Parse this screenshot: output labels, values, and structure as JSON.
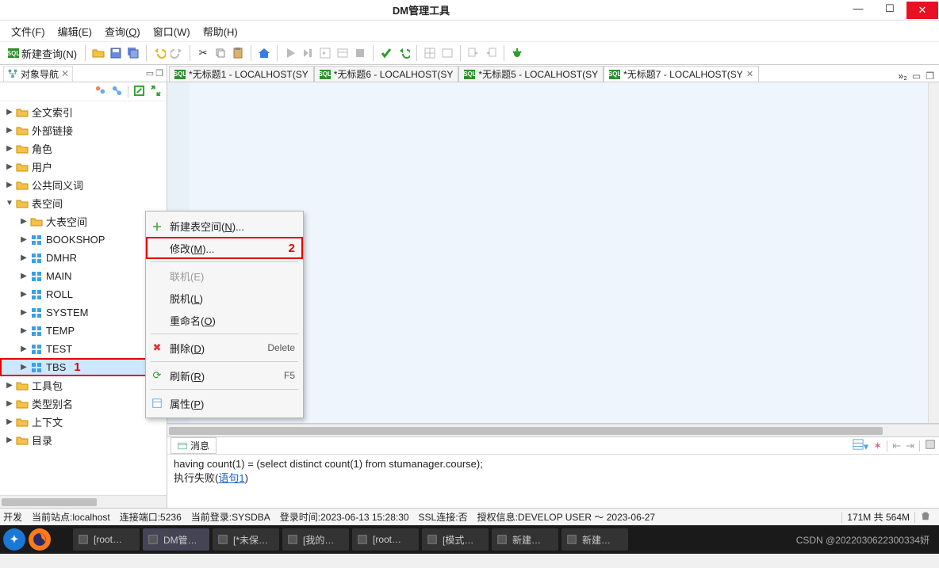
{
  "window": {
    "title": "DM管理工具"
  },
  "menu": {
    "file": "文件(F)",
    "edit": "编辑(E)",
    "query": "查询(Q)",
    "window": "窗口(W)",
    "help": "帮助(H)"
  },
  "toolbar": {
    "new_query": "新建查询(N)"
  },
  "nav_panel": {
    "title": "对象导航"
  },
  "tree": {
    "items": [
      {
        "label": "全文索引",
        "kind": "folder",
        "depth": 1,
        "twisty": "▶"
      },
      {
        "label": "外部链接",
        "kind": "folder",
        "depth": 1,
        "twisty": "▶"
      },
      {
        "label": "角色",
        "kind": "folder",
        "depth": 1,
        "twisty": "▶"
      },
      {
        "label": "用户",
        "kind": "folder",
        "depth": 1,
        "twisty": "▶"
      },
      {
        "label": "公共同义词",
        "kind": "folder",
        "depth": 1,
        "twisty": "▶"
      },
      {
        "label": "表空间",
        "kind": "folder",
        "depth": 1,
        "twisty": "▼"
      },
      {
        "label": "大表空间",
        "kind": "folder",
        "depth": 2,
        "twisty": "▶"
      },
      {
        "label": "BOOKSHOP",
        "kind": "tbs",
        "depth": 2,
        "twisty": "▶"
      },
      {
        "label": "DMHR",
        "kind": "tbs",
        "depth": 2,
        "twisty": "▶"
      },
      {
        "label": "MAIN",
        "kind": "tbs",
        "depth": 2,
        "twisty": "▶"
      },
      {
        "label": "ROLL",
        "kind": "tbs",
        "depth": 2,
        "twisty": "▶"
      },
      {
        "label": "SYSTEM",
        "kind": "tbs",
        "depth": 2,
        "twisty": "▶"
      },
      {
        "label": "TEMP",
        "kind": "tbs",
        "depth": 2,
        "twisty": "▶"
      },
      {
        "label": "TEST",
        "kind": "tbs",
        "depth": 2,
        "twisty": "▶"
      },
      {
        "label": "TBS",
        "kind": "tbs",
        "depth": 2,
        "twisty": "▶",
        "selected": true,
        "hl": "1"
      },
      {
        "label": "工具包",
        "kind": "folder",
        "depth": 1,
        "twisty": "▶"
      },
      {
        "label": "类型别名",
        "kind": "folder",
        "depth": 1,
        "twisty": "▶"
      },
      {
        "label": "上下文",
        "kind": "folder",
        "depth": 1,
        "twisty": "▶"
      },
      {
        "label": "目录",
        "kind": "folder",
        "depth": 1,
        "twisty": "▶"
      }
    ]
  },
  "editor_tabs": {
    "tabs": [
      {
        "label": "*无标题1 - LOCALHOST(SY"
      },
      {
        "label": "*无标题6 - LOCALHOST(SY"
      },
      {
        "label": "*无标题5 - LOCALHOST(SY"
      },
      {
        "label": "*无标题7 - LOCALHOST(SY",
        "active": true
      }
    ],
    "more": "»₂"
  },
  "msg": {
    "tab": "消息",
    "line1": "having count(1) = (select distinct count(1) from stumanager.course);",
    "fail_prefix": "执行失败(",
    "fail_link": "语句1",
    "fail_suffix": ")"
  },
  "status": {
    "s1": "开发",
    "s2": "当前站点:localhost",
    "s3": "连接端口:5236",
    "s4": "当前登录:SYSDBA",
    "s5": "登录时间:2023-06-13 15:28:30",
    "s6": "SSL连接:否",
    "s7": "授权信息:DEVELOP USER ～ 2023-06-27",
    "mem": "171M 共 564M"
  },
  "ctx": {
    "new_tbs": "新建表空间(N)...",
    "modify": "修改(M)...",
    "hl2": "2",
    "online": "联机(E)",
    "offline": "脱机(L)",
    "rename": "重命名(O)",
    "delete": "删除(D)",
    "delete_accel": "Delete",
    "refresh": "刷新(R)",
    "refresh_accel": "F5",
    "props": "属性(P)"
  },
  "taskbar": {
    "items": [
      {
        "label": "[root…"
      },
      {
        "label": "DM管…",
        "active": true
      },
      {
        "label": "[*未保…"
      },
      {
        "label": "[我的…"
      },
      {
        "label": "[root…"
      },
      {
        "label": "[模式…"
      },
      {
        "label": "新建…"
      },
      {
        "label": "新建…"
      }
    ],
    "clock": "CSDN @2022030622300334妍"
  }
}
